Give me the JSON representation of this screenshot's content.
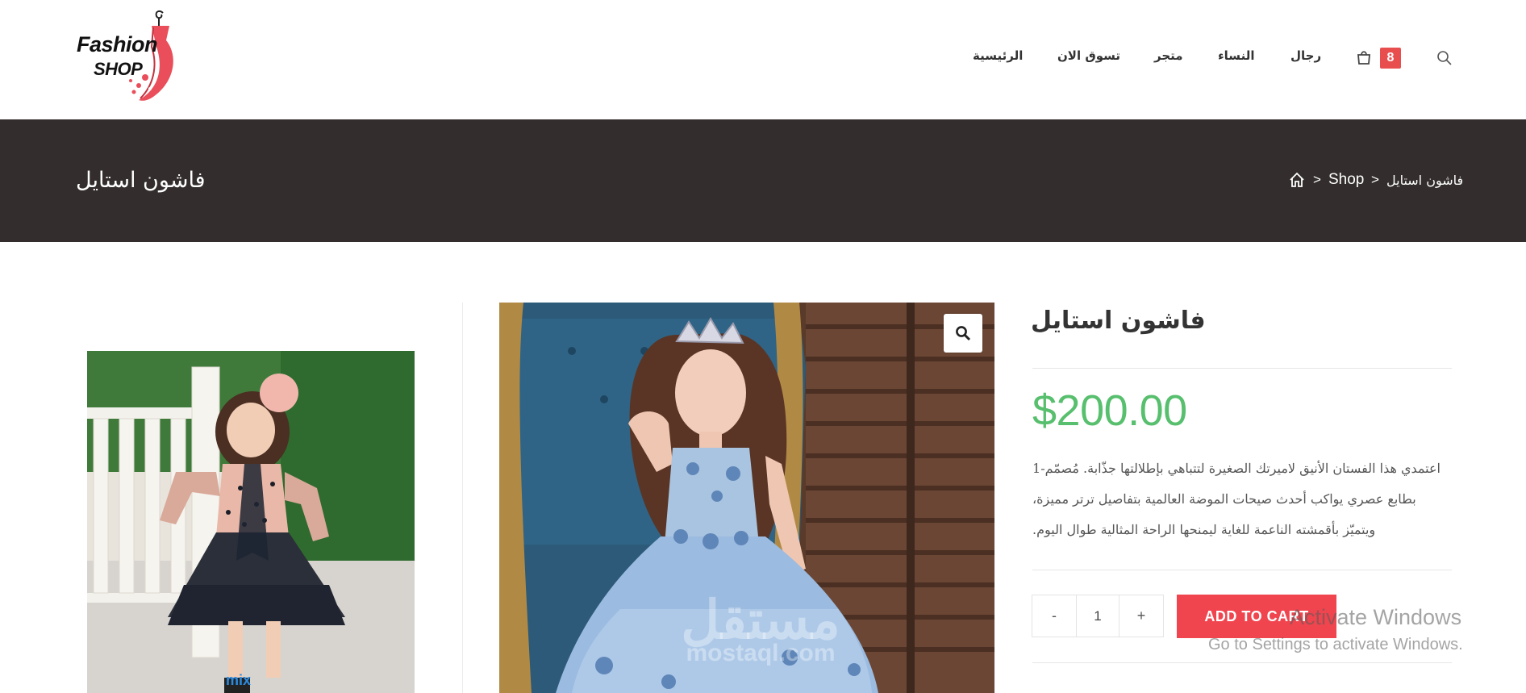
{
  "header": {
    "logo": {
      "line1": "Fashion",
      "line2": "SHOP"
    },
    "nav": [
      {
        "id": "home",
        "label": "الرئيسية"
      },
      {
        "id": "shop-now",
        "label": "تسوق الان"
      },
      {
        "id": "store",
        "label": "متجر"
      },
      {
        "id": "women",
        "label": "النساء"
      },
      {
        "id": "men",
        "label": "رجال"
      }
    ],
    "cart_count": "8",
    "icons": [
      "bag-icon",
      "search-icon"
    ]
  },
  "title_bar": {
    "title": "فاشون استايل",
    "breadcrumb": {
      "home_icon": "home-icon",
      "shop": "Shop",
      "current": "فاشون استايل",
      "separator": ">"
    }
  },
  "product": {
    "title": "فاشون استايل",
    "price": "$200.00",
    "description": [
      "اعتمدي هذا الفستان الأنيق لاميرتك الصغيرة لتتباهي بإطلالتها جذّابة. مُصمّم-1",
      "بطابع عصري يواكب أحدث صيحات الموضة العالمية بتفاصيل ترتر مميزة،",
      "ويتميّز بأقمشته الناعمة للغاية ليمنحها الراحة المثالية طوال اليوم."
    ],
    "quantity": {
      "minus": "-",
      "value": "1",
      "plus": "+"
    },
    "add_to_cart": "ADD TO CART",
    "zoom_icon": "magnifier-icon"
  },
  "watermark": {
    "windows_line1": "Activate Windows",
    "windows_line2": "Go to Settings to activate Windows.",
    "site_ar": "مستقل",
    "site_en": "mostaql.com"
  },
  "colors": {
    "accent_red": "#f0454f",
    "badge_red": "#e94e4e",
    "price_green": "#57bf6d",
    "title_bar_bg": "#332e2d"
  }
}
